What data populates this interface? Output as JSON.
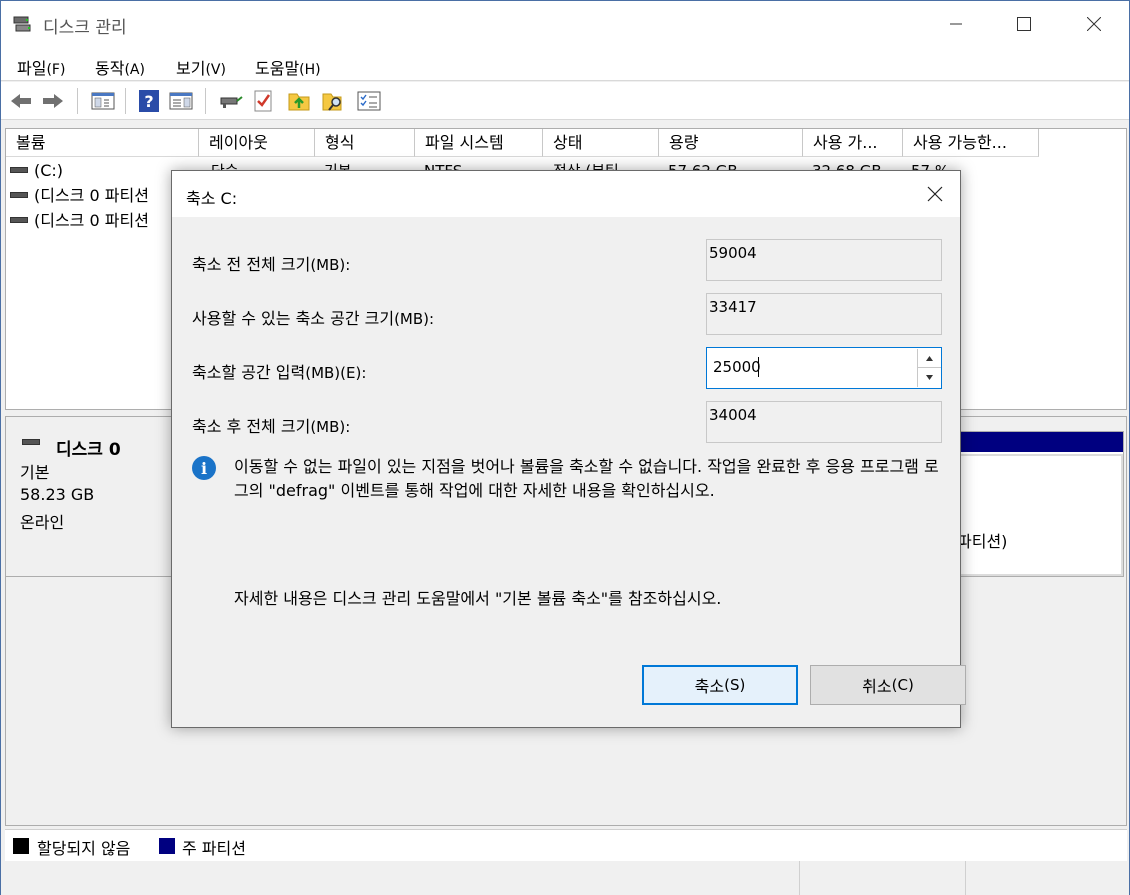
{
  "window": {
    "title": "디스크 관리",
    "minimize_glyph": "—",
    "maximize_glyph": "☐",
    "close_glyph": "✕"
  },
  "menu": [
    {
      "label": "파일",
      "mnemonic": "(F)"
    },
    {
      "label": "동작",
      "mnemonic": "(A)"
    },
    {
      "label": "보기",
      "mnemonic": "(V)"
    },
    {
      "label": "도움말",
      "mnemonic": "(H)"
    }
  ],
  "toolbar": {
    "icons": [
      "back-icon",
      "forward-icon",
      "show-hide-console-tree-icon",
      "help-icon",
      "properties-icon",
      "connect-drive-icon",
      "check-icon",
      "folder-up-icon",
      "search-folder-icon",
      "list-icon"
    ]
  },
  "volume_list": {
    "columns": [
      "볼륨",
      "레이아웃",
      "형식",
      "파일 시스템",
      "상태",
      "용량",
      "사용 가...",
      "사용 가능한..."
    ],
    "rows": [
      {
        "name": "(C:)",
        "layout": "단순",
        "type": "기본",
        "fs": "NTFS",
        "status": "정상 (부팅,",
        "capacity": "57.62 GB",
        "free": "32.68 GB",
        "pct": "57 %"
      },
      {
        "name": "(디스크 0 파티션"
      },
      {
        "name": "(디스크 0 파티션"
      }
    ]
  },
  "disk": {
    "name": "디스크 0",
    "type": "기본",
    "size": "58.23 GB",
    "status": "온라인",
    "partition_label": "파티션)"
  },
  "legend": [
    {
      "label": "할당되지 않음",
      "color": "#000000"
    },
    {
      "label": "주 파티션",
      "color": "#000080"
    }
  ],
  "dialog": {
    "title": "축소 C:",
    "close_glyph": "✕",
    "fields": {
      "total_before_label": "축소 전 전체 크기",
      "total_before_unit": "(MB):",
      "total_before_value": "59004",
      "available_label": "사용할 수 있는 축소 공간 크기",
      "available_unit": "(MB):",
      "available_value": "33417",
      "shrink_label": "축소할 공간 입력",
      "shrink_unit": "(MB)(E):",
      "shrink_value": "25000",
      "total_after_label": "축소 후 전체 크기",
      "total_after_unit": "(MB):",
      "total_after_value": "34004"
    },
    "info_icon_glyph": "i",
    "info_text": "이동할 수 없는 파일이 있는 지점을 벗어나 볼륨을 축소할 수 없습니다. 작업을 완료한 후 응용 프로그램 로그의 \"defrag\" 이벤트를 통해 작업에 대한 자세한 내용을 확인하십시오.",
    "help_text": "자세한 내용은 디스크 관리 도움말에서 \"기본 볼륨 축소\"를 참조하십시오.",
    "shrink_button": "축소",
    "shrink_mnemonic": "(S)",
    "cancel_button": "취소",
    "cancel_mnemonic": "(C)"
  }
}
